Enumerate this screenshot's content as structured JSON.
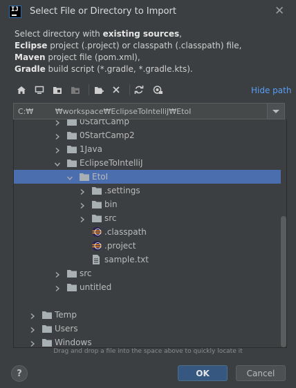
{
  "window": {
    "title": "Select File or Directory to Import",
    "app_icon_text": "IJ"
  },
  "description": {
    "l1a": "Select directory with ",
    "l1b": "existing sources",
    "l1c": ",",
    "l2a": "Eclipse",
    "l2b": " project (.project) or classpath (.classpath) file,",
    "l3a": "Maven",
    "l3b": " project file (pom.xml),",
    "l4a": "Gradle",
    "l4b": " build script (*.gradle, *.gradle.kts)."
  },
  "toolbar": {
    "icons": [
      "home-icon",
      "desktop-icon",
      "project-folder-icon",
      "module-folder-icon",
      "new-folder-icon",
      "delete-icon",
      "refresh-icon",
      "show-hidden-icon"
    ],
    "hide_path": "Hide path"
  },
  "path": {
    "value": "C:₩         ₩workspace₩EclipseToIntelliJ₩EtoI"
  },
  "tree": [
    {
      "label": "0StartCamp",
      "depth": 2,
      "type": "folder",
      "arrow": "right"
    },
    {
      "label": "0StartCamp2",
      "depth": 2,
      "type": "folder",
      "arrow": "right"
    },
    {
      "label": "1Java",
      "depth": 2,
      "type": "folder",
      "arrow": "right"
    },
    {
      "label": "EclipseToIntelliJ",
      "depth": 2,
      "type": "folder",
      "arrow": "down"
    },
    {
      "label": "EtoI",
      "depth": 3,
      "type": "folder",
      "arrow": "down",
      "selected": true
    },
    {
      "label": ".settings",
      "depth": 4,
      "type": "folder",
      "arrow": "right"
    },
    {
      "label": "bin",
      "depth": 4,
      "type": "folder",
      "arrow": "right"
    },
    {
      "label": "src",
      "depth": 4,
      "type": "folder",
      "arrow": "right"
    },
    {
      "label": ".classpath",
      "depth": 4,
      "type": "eclipse",
      "arrow": ""
    },
    {
      "label": ".project",
      "depth": 4,
      "type": "eclipse",
      "arrow": ""
    },
    {
      "label": "sample.txt",
      "depth": 4,
      "type": "file",
      "arrow": ""
    },
    {
      "label": "src",
      "depth": 2,
      "type": "folder",
      "arrow": "right"
    },
    {
      "label": "untitled",
      "depth": 2,
      "type": "folder",
      "arrow": "right"
    },
    {
      "label": "",
      "depth": 0,
      "type": "blank",
      "arrow": ""
    },
    {
      "label": "Temp",
      "depth": 0,
      "type": "folder",
      "arrow": "right"
    },
    {
      "label": "Users",
      "depth": 0,
      "type": "folder",
      "arrow": "right"
    },
    {
      "label": "Windows",
      "depth": 0,
      "type": "folder",
      "arrow": "right"
    }
  ],
  "hint": "Drag and drop a file into the space above to quickly locate it",
  "buttons": {
    "help": "?",
    "ok": "OK",
    "cancel": "Cancel"
  },
  "colors": {
    "background": "#3c3f41",
    "selection": "#4b6eaf",
    "link": "#589df6",
    "ok_button": "#365880"
  }
}
